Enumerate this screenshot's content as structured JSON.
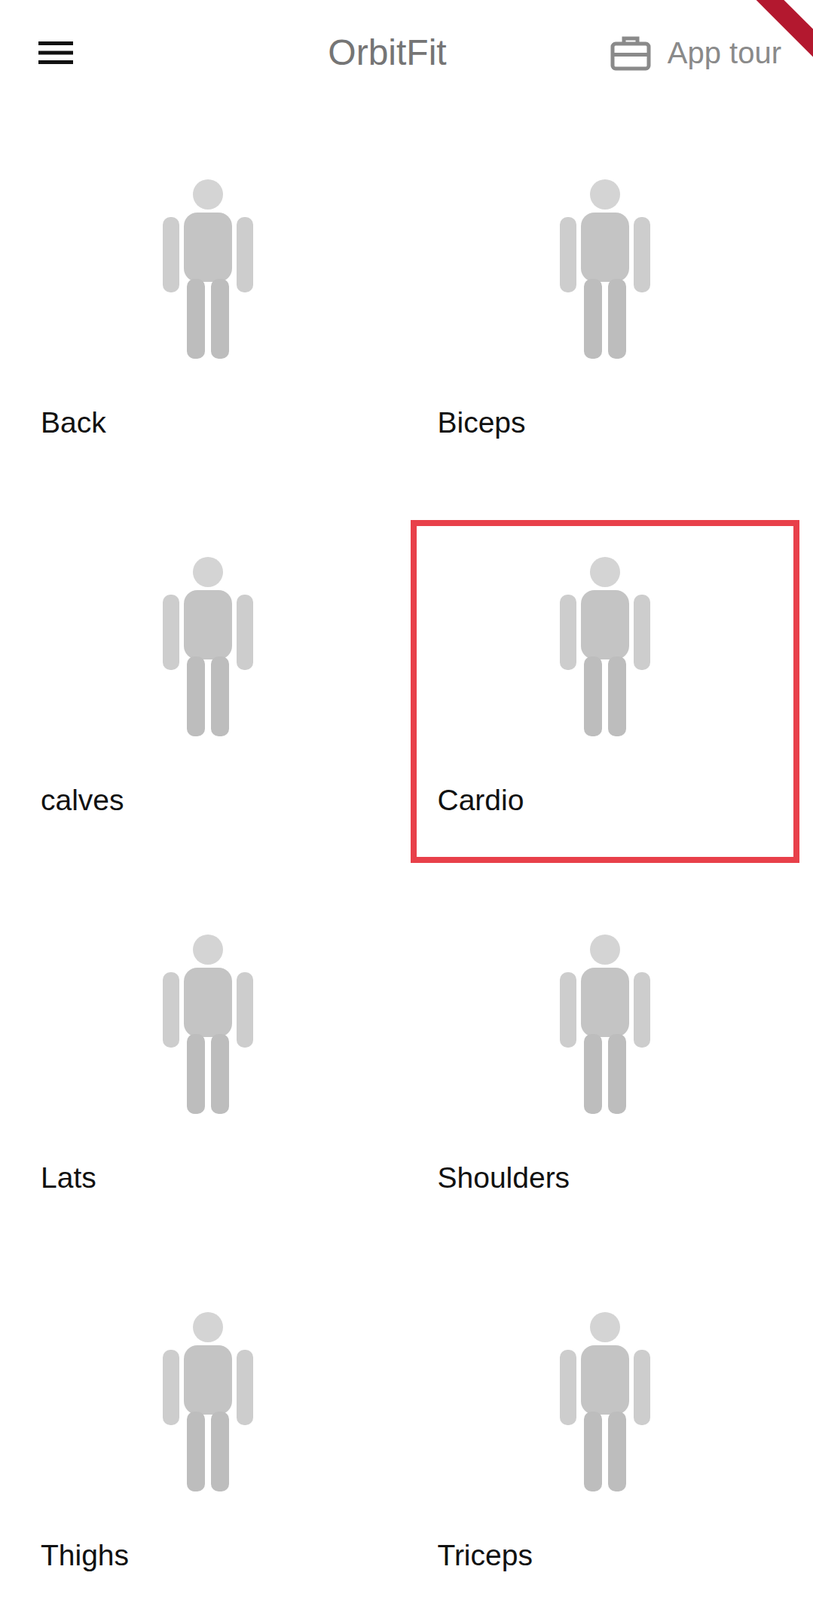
{
  "header": {
    "title": "OrbitFit",
    "action": "App tour"
  },
  "categories": [
    {
      "label": "Back",
      "selected": false
    },
    {
      "label": "Biceps",
      "selected": false
    },
    {
      "label": "calves",
      "selected": false
    },
    {
      "label": "Cardio",
      "selected": true
    },
    {
      "label": "Lats",
      "selected": false
    },
    {
      "label": "Shoulders",
      "selected": false
    },
    {
      "label": "Thighs",
      "selected": false
    },
    {
      "label": "Triceps",
      "selected": false
    }
  ]
}
